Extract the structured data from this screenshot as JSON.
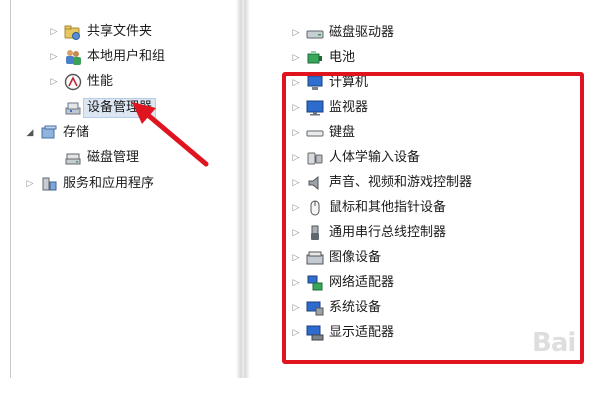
{
  "left_tree": {
    "items": [
      {
        "label": "共享文件夹",
        "icon": "shared-folder-icon"
      },
      {
        "label": "本地用户和组",
        "icon": "users-group-icon"
      },
      {
        "label": "性能",
        "icon": "performance-icon"
      },
      {
        "label": "设备管理器",
        "icon": "device-manager-icon"
      },
      {
        "label": "存储",
        "icon": "storage-icon"
      },
      {
        "label": "磁盘管理",
        "icon": "disk-management-icon"
      },
      {
        "label": "服务和应用程序",
        "icon": "services-icon"
      }
    ]
  },
  "right_tree": {
    "items": [
      {
        "label": "磁盘驱动器",
        "icon": "disk-drive-icon"
      },
      {
        "label": "电池",
        "icon": "battery-icon"
      },
      {
        "label": "计算机",
        "icon": "computer-icon"
      },
      {
        "label": "监视器",
        "icon": "monitor-icon"
      },
      {
        "label": "键盘",
        "icon": "keyboard-icon"
      },
      {
        "label": "人体学输入设备",
        "icon": "hid-icon"
      },
      {
        "label": "声音、视频和游戏控制器",
        "icon": "speaker-icon"
      },
      {
        "label": "鼠标和其他指针设备",
        "icon": "mouse-icon"
      },
      {
        "label": "通用串行总线控制器",
        "icon": "usb-icon"
      },
      {
        "label": "图像设备",
        "icon": "imaging-device-icon"
      },
      {
        "label": "网络适配器",
        "icon": "network-adapter-icon"
      },
      {
        "label": "系统设备",
        "icon": "system-device-icon"
      },
      {
        "label": "显示适配器",
        "icon": "display-adapter-icon"
      }
    ]
  },
  "annotation": {
    "highlight_color": "#e0141e"
  },
  "watermark": "Bai"
}
